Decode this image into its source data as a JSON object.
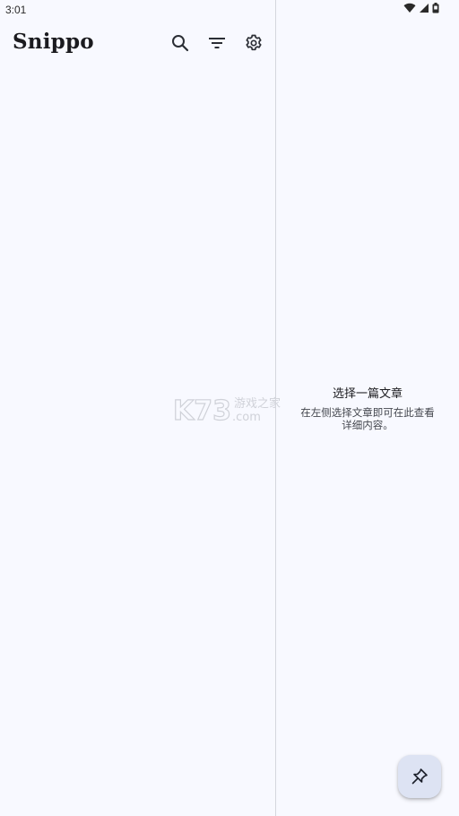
{
  "status_bar": {
    "time": "3:01",
    "icons": [
      "wifi-icon",
      "signal-icon",
      "battery-icon"
    ]
  },
  "app": {
    "title": "Snippo"
  },
  "toolbar": {
    "actions": [
      {
        "name": "search",
        "icon": "search-icon"
      },
      {
        "name": "filter",
        "icon": "filter-icon"
      },
      {
        "name": "settings",
        "icon": "gear-icon"
      }
    ]
  },
  "watermark": {
    "logo": "K73",
    "text_top": "游戏之家",
    "text_bottom": ".com"
  },
  "detail_pane": {
    "empty_title": "选择一篇文章",
    "empty_description": "在左侧选择文章即可在此查看详细内容。"
  },
  "fab": {
    "icon": "pin-icon"
  },
  "colors": {
    "background": "#f8f9ff",
    "divider": "#d4d6dd",
    "fab_background": "#dde3f3",
    "text_primary": "#1b1b1f",
    "text_secondary": "#44474e"
  }
}
